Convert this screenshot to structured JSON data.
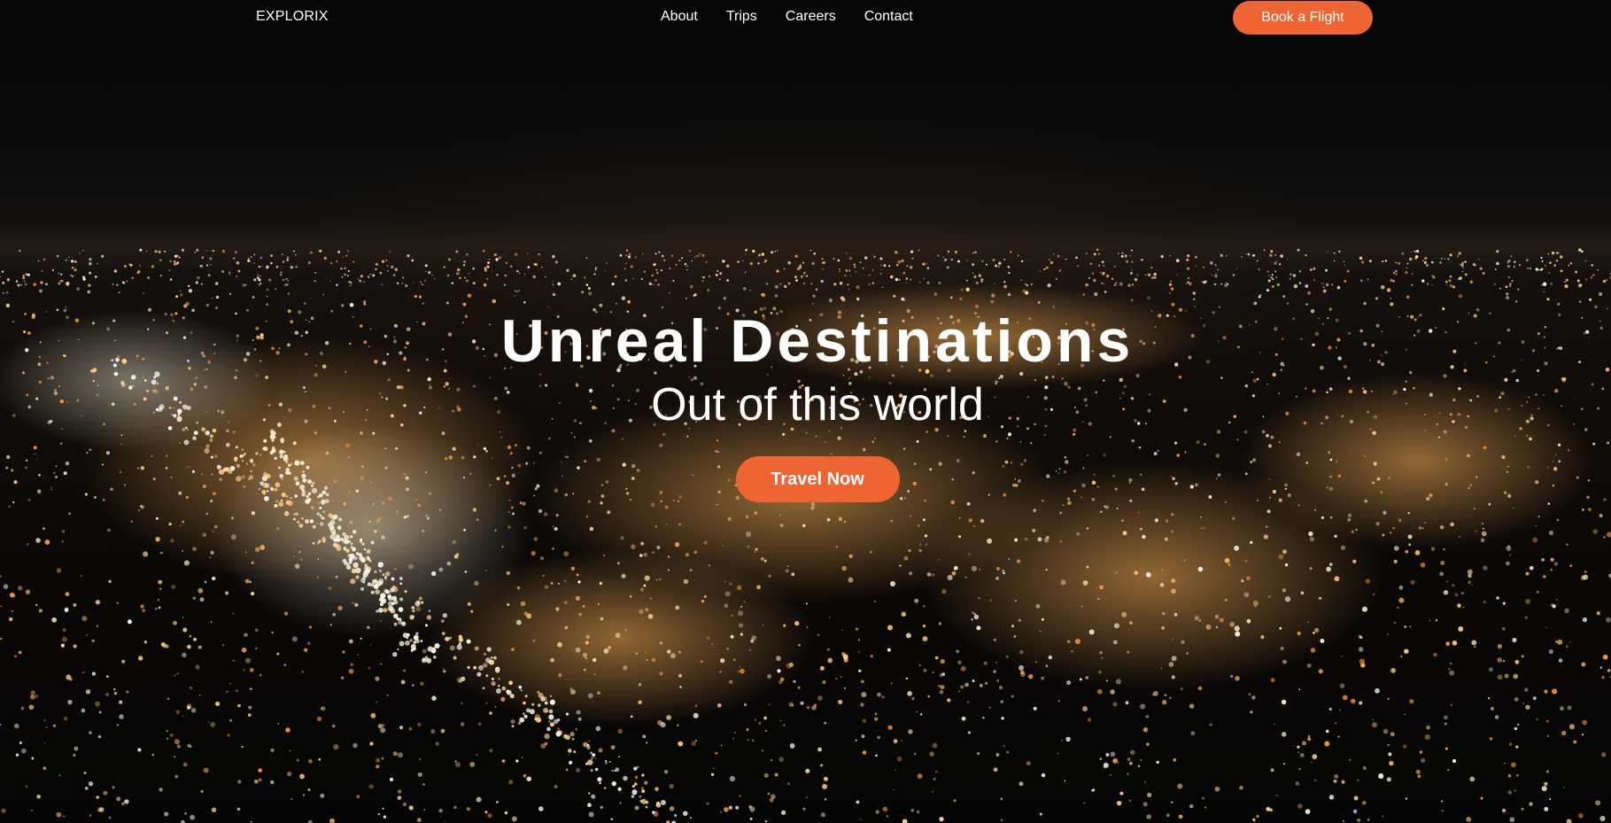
{
  "navbar": {
    "logo": "EXPLORIX",
    "links": [
      "About",
      "Trips",
      "Careers",
      "Contact"
    ],
    "cta_label": "Book a Flight"
  },
  "hero": {
    "title": "Unreal Destinations",
    "subtitle": "Out of this world",
    "cta_label": "Travel Now",
    "background": "night-city-aerial-image"
  },
  "colors": {
    "accent": "#ee6433",
    "text": "#ffffff",
    "background": "#050505"
  }
}
